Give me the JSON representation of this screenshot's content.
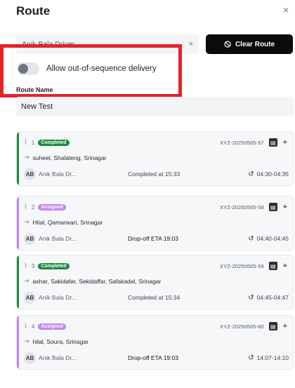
{
  "header": {
    "title": "Route",
    "close_icon": "×"
  },
  "driver": {
    "value": "Anik Bala Driver",
    "clear_icon": "×"
  },
  "clear_route": {
    "label": "Clear Route",
    "icon": "ban-icon"
  },
  "toggle": {
    "label": "Allow out-of-sequence delivery",
    "on": false
  },
  "route_name": {
    "label": "Route Name",
    "value": "New Test"
  },
  "colors": {
    "completed": "#1a8a3e",
    "assigned": "#c086f0",
    "highlight": "#e3242b"
  },
  "stops": [
    {
      "seq": "1",
      "status": "Completed",
      "order_id": "XYZ-20250505-57",
      "address": "suheel, Shalateng, Srinagar",
      "driver_initials": "AB",
      "driver_name": "Anik Bala Dr...",
      "status_text": "Completed at 15:33",
      "time": "04:30-04:35"
    },
    {
      "seq": "2",
      "status": "Assigned",
      "order_id": "XYZ-20250505-58",
      "address": "Hilal, Qamarwari, Srinagar",
      "driver_initials": "AB",
      "driver_name": "Anik Bala Dr...",
      "status_text": "Drop-off ETA 19:03",
      "time": "04:40-04:45"
    },
    {
      "seq": "3",
      "status": "Completed",
      "order_id": "XYZ-20250505-55",
      "address": "ashar, Sakidafar, Sekidaffar, Safakadal, Srinagar",
      "driver_initials": "AB",
      "driver_name": "Anik Bala Dr...",
      "status_text": "Completed at 15:34",
      "time": "04:45-04:47"
    },
    {
      "seq": "4",
      "status": "Assigned",
      "order_id": "XYZ-20250505-60",
      "address": "hilal, Soura, Srinagar",
      "driver_initials": "AB",
      "driver_name": "Anik Bala Dr...",
      "status_text": "Drop-off ETA 19:03",
      "time": "14:07-14:10"
    }
  ]
}
